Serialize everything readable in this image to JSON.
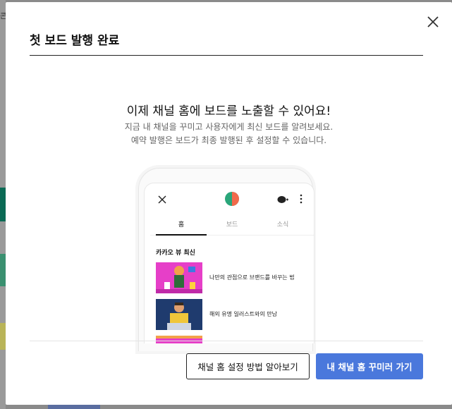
{
  "background": {
    "side_text": "콘"
  },
  "modal": {
    "title": "첫 보드 발행 완료",
    "headline": "이제 채널 홈에 보드를 노출할 수 있어요!",
    "subtext_line1": "지금 내 채널을 꾸미고 사용자에게 최신 보드를 알려보세요.",
    "subtext_line2": "예약 발행은 보드가 최종 발행된 후 설정할 수 있습니다.",
    "close_icon": "close-icon"
  },
  "phone": {
    "tabs": [
      "홈",
      "보드",
      "소식"
    ],
    "active_tab": "홈",
    "section_title": "카카오 뷰 최신",
    "items": [
      {
        "title": "나만의 관점으로 브랜드를 바꾸는 법"
      },
      {
        "title": "해외 유명 일러스트와의 만남"
      }
    ]
  },
  "footer": {
    "secondary_button": "채널 홈 설정 방법 알아보기",
    "primary_button": "내 채널 홈 꾸미러 가기"
  },
  "colors": {
    "primary": "#4a78dc",
    "thumb_magenta": "#e63fc8",
    "thumb_navy": "#1f3b6e"
  }
}
